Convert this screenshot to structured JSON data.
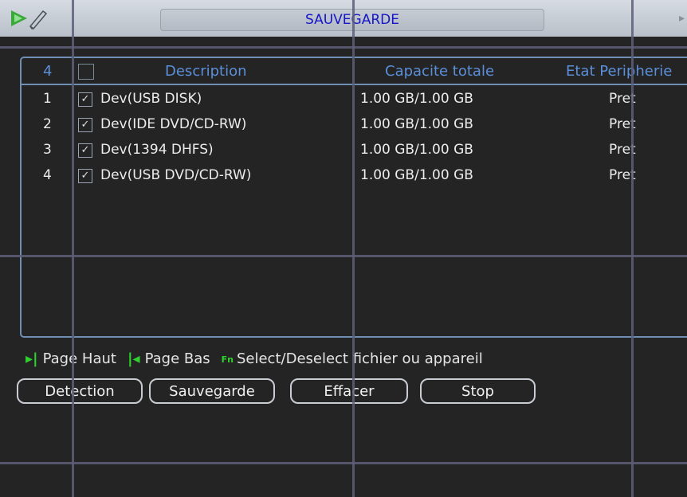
{
  "window": {
    "title": "SAUVEGARDE"
  },
  "table": {
    "headers": {
      "count": "4",
      "description": "Description",
      "capacity": "Capacite totale",
      "status": "Etat Peripherie"
    },
    "rows": [
      {
        "index": "1",
        "checked": true,
        "description": "Dev(USB DISK)",
        "capacity": "1.00 GB/1.00 GB",
        "status": "Pret"
      },
      {
        "index": "2",
        "checked": true,
        "description": "Dev(IDE DVD/CD-RW)",
        "capacity": "1.00 GB/1.00 GB",
        "status": "Pret"
      },
      {
        "index": "3",
        "checked": true,
        "description": "Dev(1394 DHFS)",
        "capacity": "1.00 GB/1.00 GB",
        "status": "Pret"
      },
      {
        "index": "4",
        "checked": true,
        "description": "Dev(USB DVD/CD-RW)",
        "capacity": "1.00 GB/1.00 GB",
        "status": "Pret"
      }
    ]
  },
  "hints": {
    "page_up_icon": "page-up-icon",
    "page_up": "Page Haut",
    "page_down_icon": "page-down-icon",
    "page_down": "Page Bas",
    "fn_icon_text": "Fn",
    "fn_text": "Select/Deselect fichier ou appareil"
  },
  "buttons": {
    "detection": "Detection",
    "backup": "Sauvegarde",
    "erase": "Effacer",
    "stop": "Stop"
  },
  "colors": {
    "header_text": "#5b8fd9",
    "title_text": "#1616c8",
    "border": "#6f8fb5",
    "hint_icon": "#2fd12f"
  }
}
